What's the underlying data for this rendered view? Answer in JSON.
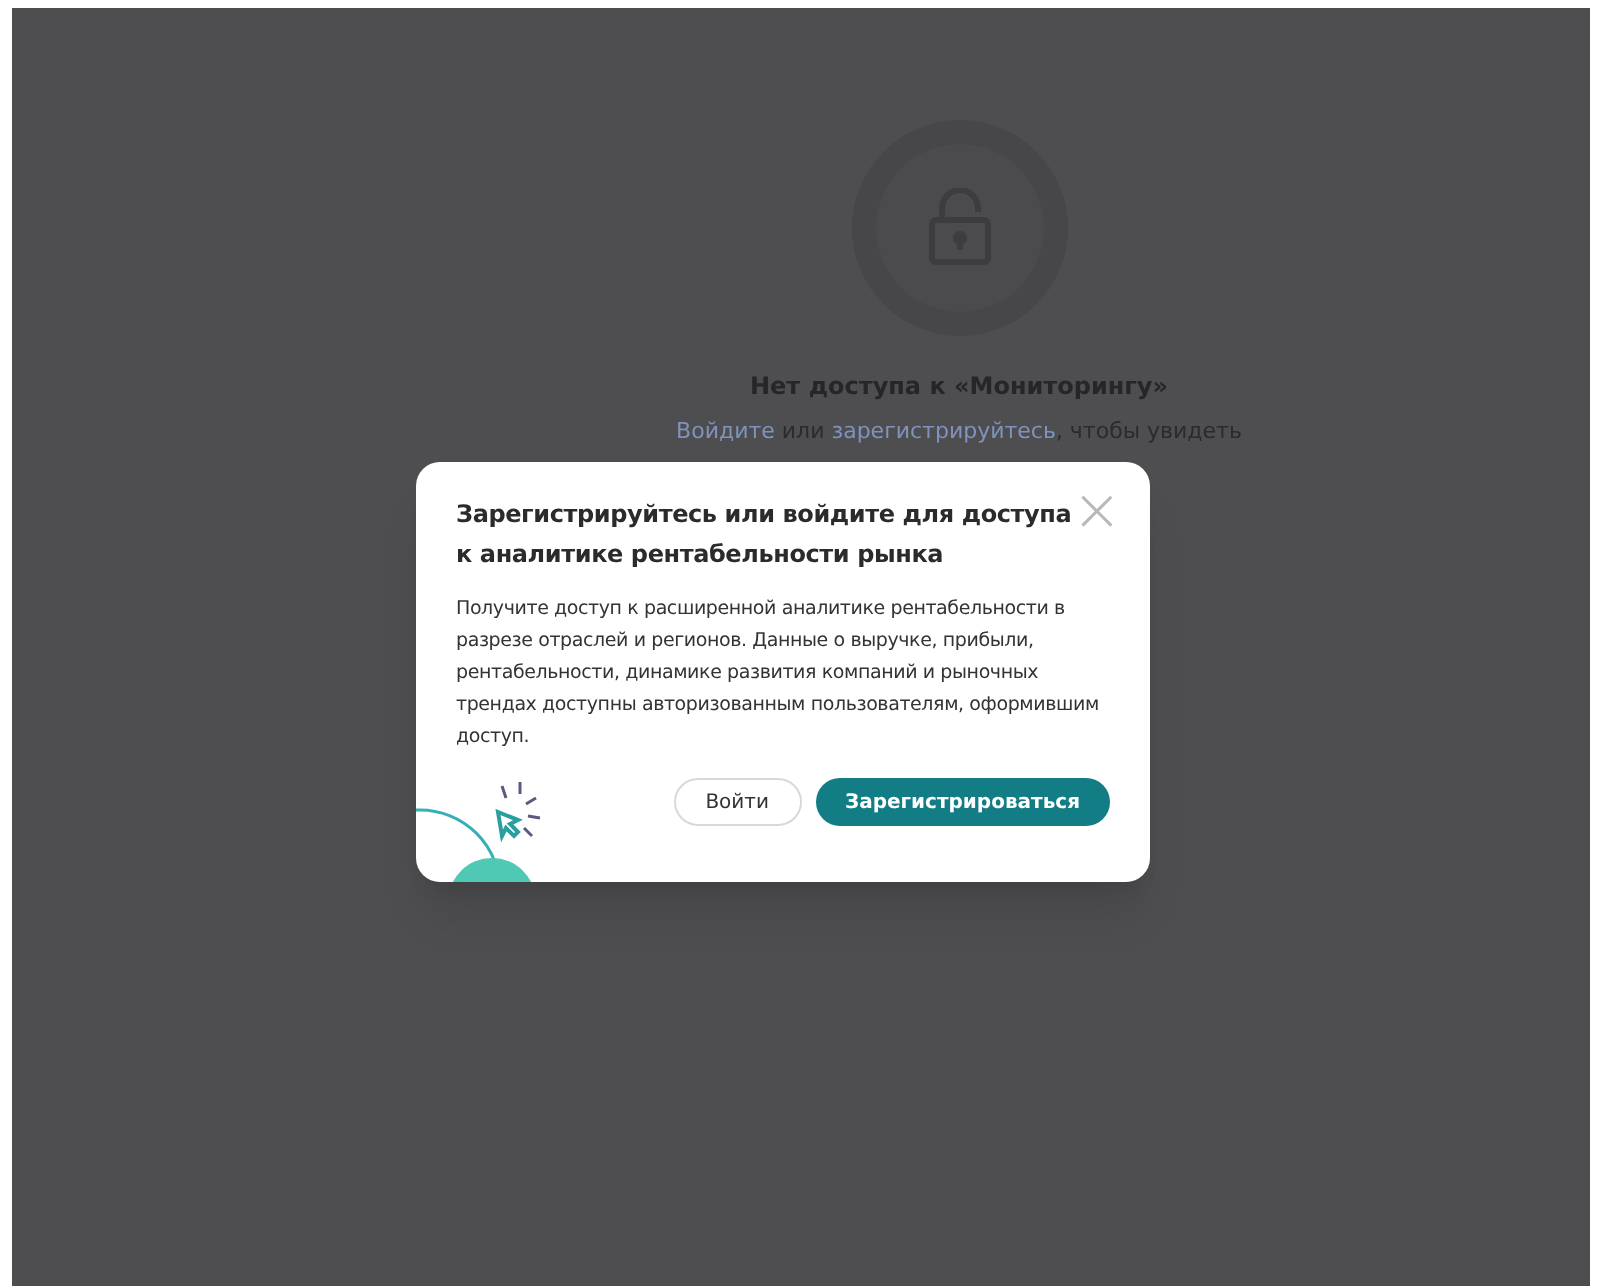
{
  "background": {
    "title": "Нет доступа к «Мониторингу»",
    "message_parts": [
      {
        "kind": "link",
        "text": "Войдите"
      },
      {
        "kind": "text",
        "text": " или "
      },
      {
        "kind": "link",
        "text": "зарегистрируйтесь"
      },
      {
        "kind": "text",
        "text": ", чтобы увидеть"
      }
    ]
  },
  "dialog": {
    "title": "Зарегистрируйтесь или войдите для доступа к аналитике рентабельности рынка",
    "close": "×",
    "body": "Получите доступ к расширенной аналитике рентабельности в разрезе отраслей и регионов. Данные о выручке, прибыли, рентабельности, динамике развития компаний и рыночных трендах доступны авторизованным пользователям, оформившим доступ.",
    "buttons": [
      {
        "kind": "secondary",
        "label": "Войти"
      },
      {
        "kind": "primary",
        "label": "Зарегистрироваться"
      }
    ]
  }
}
